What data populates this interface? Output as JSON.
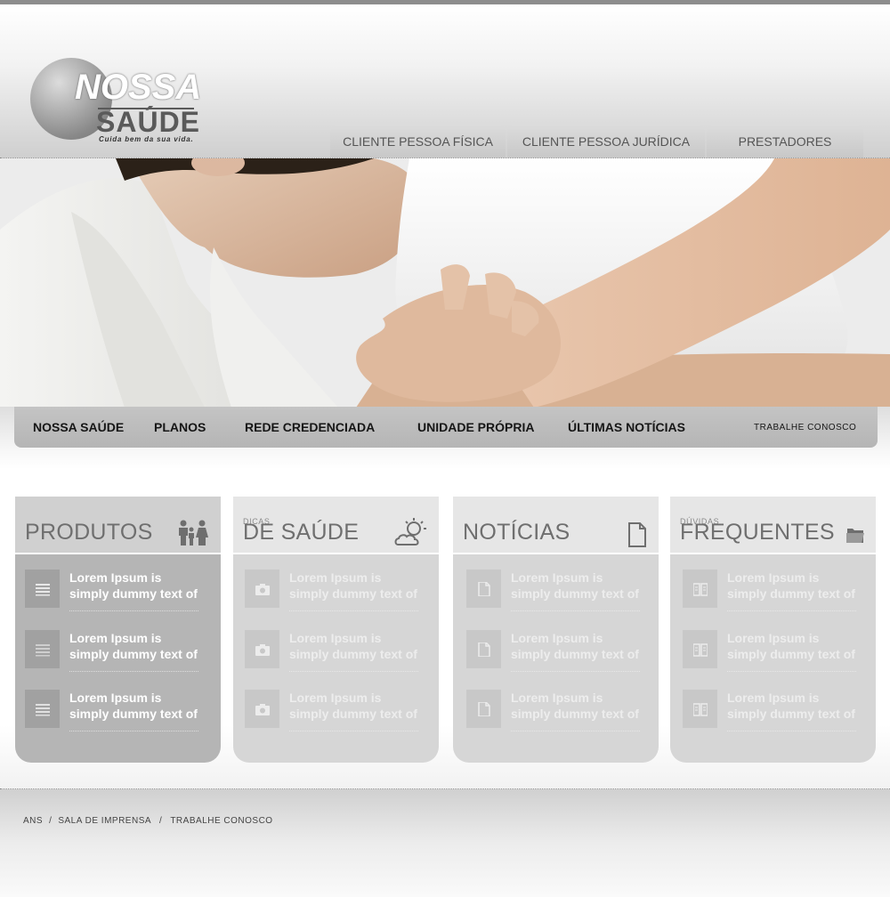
{
  "brand": {
    "name_line1": "NOSSA",
    "name_line2": "SAÚDE",
    "tagline": "Cuida bem da sua vida."
  },
  "top_tabs": [
    {
      "label": "CLIENTE PESSOA FÍSICA"
    },
    {
      "label": "CLIENTE PESSOA JURÍDICA"
    },
    {
      "label": "PRESTADORES"
    }
  ],
  "main_nav": [
    {
      "label": "NOSSA SAÚDE"
    },
    {
      "label": "PLANOS"
    },
    {
      "label": "REDE CREDENCIADA"
    },
    {
      "label": "UNIDADE PRÓPRIA"
    },
    {
      "label": "ÚLTIMAS NOTÍCIAS"
    },
    {
      "label": "TRABALHE CONOSCO"
    }
  ],
  "boxes": [
    {
      "pretitle": "",
      "title": "PRODUTOS",
      "icon": "family-icon",
      "item_icon": "list-icon",
      "items": [
        {
          "text_line1": "Lorem Ipsum is",
          "text_line2": "simply dummy text of"
        },
        {
          "text_line1": "Lorem Ipsum is",
          "text_line2": "simply dummy text of"
        },
        {
          "text_line1": "Lorem Ipsum is",
          "text_line2": "simply dummy text of"
        }
      ]
    },
    {
      "pretitle": "DICAS",
      "title": "DE SAÚDE",
      "icon": "weather-icon",
      "item_icon": "camera-icon",
      "items": [
        {
          "text_line1": "Lorem Ipsum is",
          "text_line2": "simply dummy text of"
        },
        {
          "text_line1": "Lorem Ipsum is",
          "text_line2": "simply dummy text of"
        },
        {
          "text_line1": "Lorem Ipsum is",
          "text_line2": "simply dummy text of"
        }
      ]
    },
    {
      "pretitle": "",
      "title": "NOTÍCIAS",
      "icon": "document-icon",
      "item_icon": "document-icon",
      "items": [
        {
          "text_line1": "Lorem Ipsum is",
          "text_line2": "simply dummy text of"
        },
        {
          "text_line1": "Lorem Ipsum is",
          "text_line2": "simply dummy text of"
        },
        {
          "text_line1": "Lorem Ipsum is",
          "text_line2": "simply dummy text of"
        }
      ]
    },
    {
      "pretitle": "DÚVIDAS",
      "title": "FREQUENTES",
      "icon": "folder-icon",
      "item_icon": "book-icon",
      "items": [
        {
          "text_line1": "Lorem Ipsum is",
          "text_line2": "simply dummy text of"
        },
        {
          "text_line1": "Lorem Ipsum is",
          "text_line2": "simply dummy text of"
        },
        {
          "text_line1": "Lorem Ipsum is",
          "text_line2": "simply dummy text of"
        }
      ]
    }
  ],
  "footer": {
    "links": [
      {
        "label": "ANS"
      },
      {
        "label": "SALA DE IMPRENSA"
      },
      {
        "label": "TRABALHE CONOSCO"
      }
    ],
    "separator": "/"
  },
  "colors": {
    "top_bar": "#8d8d8d",
    "nav_bar": "#b9b9b9",
    "box_dark": "#b5b5b5",
    "box_light": "#d6d6d6"
  }
}
